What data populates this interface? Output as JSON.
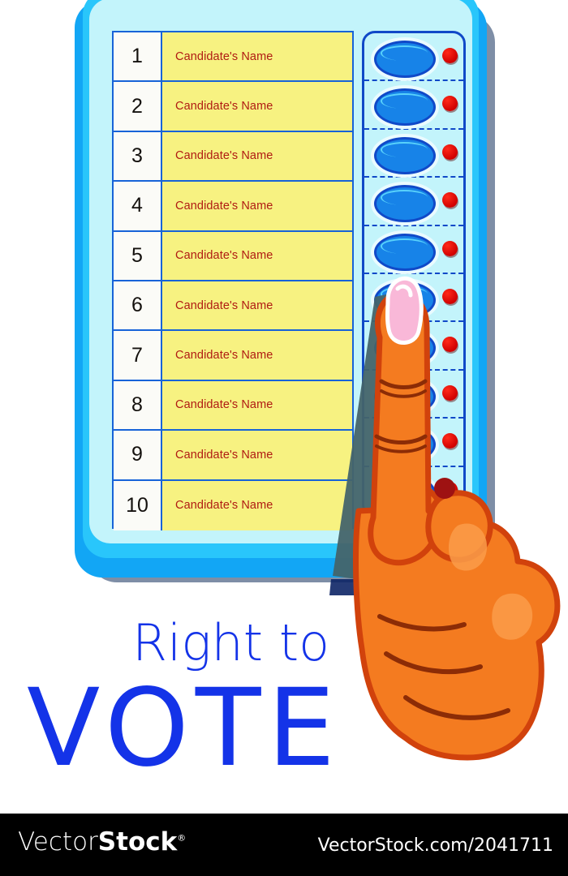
{
  "poster": {
    "headline_line1": "Right to",
    "headline_line2": "VOTE",
    "headline_color": "#1433e8"
  },
  "machine": {
    "label": "electronic-voting-machine",
    "body_color": "#29c6fb",
    "face_color": "#c3f4fb",
    "indicator_leds": [
      {
        "name": "power-led",
        "color": "#0aa80b"
      },
      {
        "name": "ready-led",
        "color": "#0fb6ef"
      }
    ],
    "top_tabs": 2
  },
  "ballot": {
    "name_cell_color": "#f7f281",
    "name_text_color": "#b01b13",
    "border_color": "#1763d8",
    "rows": [
      {
        "number": "1",
        "name": "Candidate's Name"
      },
      {
        "number": "2",
        "name": "Candidate's Name"
      },
      {
        "number": "3",
        "name": "Candidate's Name"
      },
      {
        "number": "4",
        "name": "Candidate's Name"
      },
      {
        "number": "5",
        "name": "Candidate's Name"
      },
      {
        "number": "6",
        "name": "Candidate's Name"
      },
      {
        "number": "7",
        "name": "Candidate's Name"
      },
      {
        "number": "8",
        "name": "Candidate's Name"
      },
      {
        "number": "9",
        "name": "Candidate's Name"
      },
      {
        "number": "10",
        "name": "Candidate's Name"
      }
    ]
  },
  "buttons": {
    "button_color": "#1783e8",
    "led_color": "#cf0000",
    "count": 10,
    "pressed_index": 6
  },
  "hand": {
    "skin_color": "#f47b20",
    "nail_color": "#f9b8d8",
    "gesture": "index-finger-pressing-button-6"
  },
  "watermark": {
    "logo_thin": "Vector",
    "logo_bold": "Stock",
    "logo_mark": "®",
    "url": "VectorStock.com/2041711",
    "bar_color": "#000000"
  }
}
